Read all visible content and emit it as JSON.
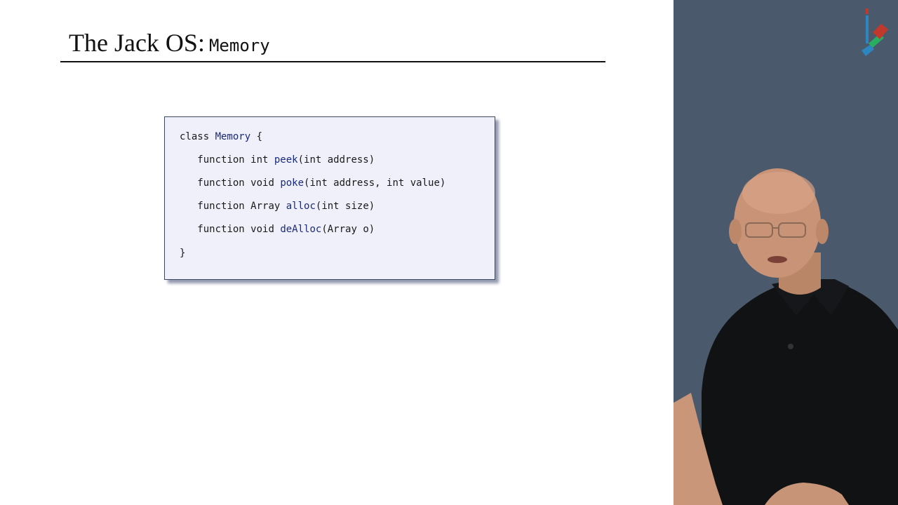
{
  "slide": {
    "title_text": "The Jack OS:",
    "title_class": "Memory"
  },
  "code": {
    "lines": [
      {
        "indent": "",
        "before": "class ",
        "name": "Memory",
        "after": " {"
      },
      {
        "indent": "   ",
        "before": "function int ",
        "name": "peek",
        "after": "(int address)"
      },
      {
        "indent": "   ",
        "before": "function void ",
        "name": "poke",
        "after": "(int address, int value)"
      },
      {
        "indent": "   ",
        "before": "function Array ",
        "name": "alloc",
        "after": "(int size)"
      },
      {
        "indent": "   ",
        "before": "function void ",
        "name": "deAlloc",
        "after": "(Array o)"
      },
      {
        "indent": "",
        "before": "}",
        "name": "",
        "after": ""
      }
    ]
  },
  "colors": {
    "panel_bg": "#4b596c",
    "code_bg": "#f0f0fa",
    "code_border": "#3b4763",
    "identifier": "#1a2a7a"
  },
  "icons": {
    "logo": "nand2tetris-logo-icon",
    "presenter": "presenter-video"
  }
}
